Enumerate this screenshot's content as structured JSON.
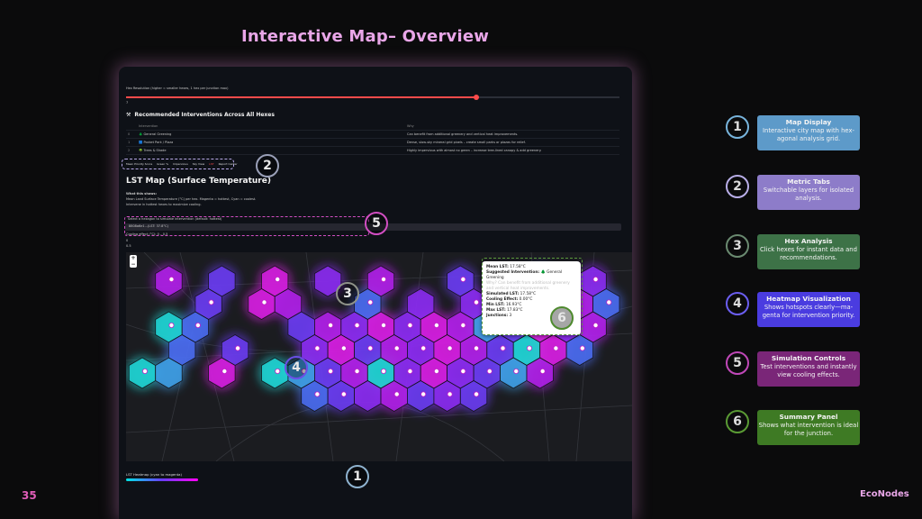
{
  "slide": {
    "title": "Interactive Map– Overview",
    "page_number": "35",
    "brand": "EcoNodes"
  },
  "app": {
    "hex_resolution_label": "Hex Resolution (higher = smaller hexes, 1 hex per junction max)",
    "slider_value": "7",
    "slider_fraction": 0.71,
    "rec_title": "Recommended Interventions Across All Hexes",
    "rec_icon": "tools-icon",
    "rec_columns": [
      "Intervention",
      "Why"
    ],
    "rec_rows": [
      {
        "index": "0",
        "name": "🌲 General Greening",
        "why": "Can benefit from additional greenery and vertical heat improvements."
      },
      {
        "index": "1",
        "name": "🟦 Pocket Park / Plaza",
        "why": "Dense, slow-sky mineral grid pixels – create small parks or plazas for relief."
      },
      {
        "index": "2",
        "name": "🌳 Trees & Shade",
        "why": "Highly impervious with almost no green – increase tree-lined canopy & add greenery."
      }
    ],
    "tabs": [
      "Mean Priority Score",
      "Green %",
      "Impervious",
      "Sky View",
      "LST",
      "Report Center"
    ],
    "active_tab": "LST",
    "lst_title": "LST Map (Surface Temperature)",
    "what_shows": [
      "What this shows:",
      "Mean Land Surface Temperature (°C) per hex. Magenta = hottest, Cyan = coolest.",
      "Intervene in hottest hexes to maximize cooling."
    ],
    "sim_label": "Select a hexagon to simulate intervention (default: hottest)",
    "sim_value": "8808a6e1...(LST: 37.8°C)",
    "sim_note": "Cooling effect (°C): 0 – 0.5",
    "small_marks": [
      "0",
      "0.5"
    ],
    "zoom": [
      "+",
      "−"
    ],
    "popup": {
      "mean_lst_label": "Mean LST:",
      "mean_lst": "17.58°C",
      "suggested_label": "Suggested Intervention:",
      "suggested": "🌲 General Greening",
      "why_text": "Why? Can benefit from additional greenery and vertical heat improvements.",
      "simulated_label": "Simulated LST:",
      "simulated": "17.58°C",
      "cooling_label": "Cooling Effect:",
      "cooling": "0.00°C",
      "min_label": "Min LST:",
      "min": "16.93°C",
      "max_label": "Max LST:",
      "max": "17.83°C",
      "junctions_label": "Junctions:",
      "junctions": "3"
    },
    "legend_title": "LST Heatmap (cyan to magenta)"
  },
  "map_rings": [
    {
      "num": "2",
      "color": "#9aa0b8"
    },
    {
      "num": "3",
      "color": "#8f9389"
    },
    {
      "num": "4",
      "color": "#6b4ee6"
    },
    {
      "num": "5",
      "color": "#d14ec2"
    },
    {
      "num": "6",
      "color": "#4e8a2e"
    },
    {
      "num": "1",
      "color": "#8fb3d0"
    }
  ],
  "callouts": [
    {
      "num": "1",
      "title": "Map Display",
      "desc": "Interactive city map with hex-agonal analysis grid.",
      "color": "#5d9ac9",
      "ring": "#78b4dc"
    },
    {
      "num": "2",
      "title": "Metric Tabs",
      "desc": "Switchable layers for isolated analysis.",
      "color": "#8d7cc9",
      "ring": "#b9aee8"
    },
    {
      "num": "3",
      "title": "Hex Analysis",
      "desc": "Click hexes for instant data and recommendations.",
      "color": "#3d7247",
      "ring": "#6a8a70"
    },
    {
      "num": "4",
      "title": "Heatmap Visualization",
      "desc": "Shows hotspots clearly—ma-genta for intervention priority.",
      "color": "#4a3ce0",
      "ring": "#6b5ef0"
    },
    {
      "num": "5",
      "title": "Simulation Controls",
      "desc": "Test interventions and instantly view cooling effects.",
      "color": "#7a2678",
      "ring": "#c048b8"
    },
    {
      "num": "6",
      "title": "Summary Panel",
      "desc": "Shows what intervention is ideal for the junction.",
      "color": "#3e7a24",
      "ring": "#5a9a34"
    }
  ]
}
